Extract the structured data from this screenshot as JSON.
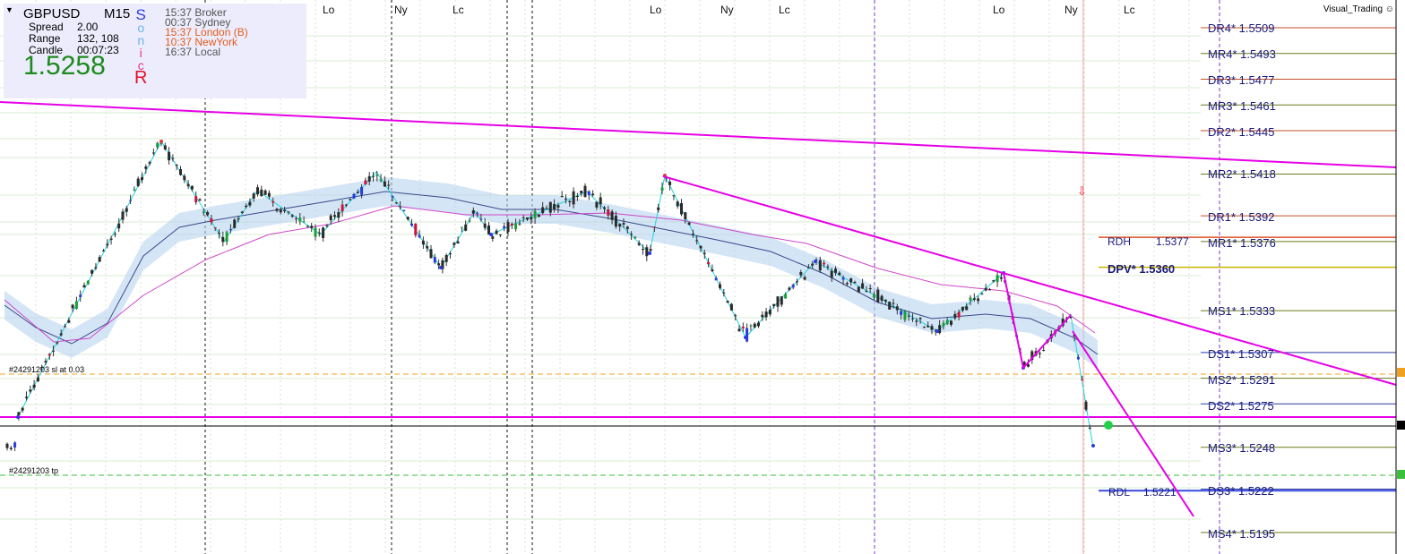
{
  "header": {
    "dropdown": "▼",
    "symbol": "GBPUSD",
    "timeframe": "M15",
    "spread_label": "Spread",
    "spread": "2.00",
    "range_label": "Range",
    "range": "132, 108",
    "candle_label": "Candle",
    "candle": "00:07:23",
    "price": "1.5258",
    "sonic": [
      "S",
      "o",
      "n",
      "i",
      "c",
      "R"
    ],
    "sessions": [
      {
        "text": "15:37 Broker",
        "color": "#555555"
      },
      {
        "text": "00:37 Sydney",
        "color": "#555555"
      },
      {
        "text": "15:37 London  (B)",
        "color": "#e25c1c"
      },
      {
        "text": "10:37 NewYork",
        "color": "#e25c1c"
      },
      {
        "text": "16:37 Local",
        "color": "#555555"
      }
    ],
    "visual_trading": "Visual_Trading ☺"
  },
  "session_labels": [
    "Lo",
    "Ny",
    "Lc",
    "Lo",
    "Ny",
    "Lc",
    "Lo",
    "Ny",
    "Lc"
  ],
  "pivots": [
    {
      "label": "DR4* 1.5509",
      "bold": false,
      "price": 1.5509
    },
    {
      "label": "MR4* 1.5493",
      "bold": false,
      "price": 1.5493
    },
    {
      "label": "DR3* 1.5477",
      "bold": false,
      "price": 1.5477
    },
    {
      "label": "MR3* 1.5461",
      "bold": false,
      "price": 1.5461
    },
    {
      "label": "DR2* 1.5445",
      "bold": false,
      "price": 1.5445
    },
    {
      "label": "MR2* 1.5418",
      "bold": false,
      "price": 1.5418
    },
    {
      "label": "DR1* 1.5392",
      "bold": false,
      "price": 1.5392
    },
    {
      "label": "MR1* 1.5376",
      "bold": false,
      "price": 1.5376
    },
    {
      "label": "MS1* 1.5333",
      "bold": false,
      "price": 1.5333
    },
    {
      "label": "DS1* 1.5307",
      "bold": false,
      "price": 1.5307
    },
    {
      "label": "MS2* 1.5291",
      "bold": false,
      "price": 1.5291
    },
    {
      "label": "DS2* 1.5275",
      "bold": false,
      "price": 1.5275
    },
    {
      "label": "MS3* 1.5248",
      "bold": false,
      "price": 1.5248
    },
    {
      "label": "DS3* 1.5222",
      "bold": false,
      "price": 1.5222
    },
    {
      "label": "MS4* 1.5195",
      "bold": false,
      "price": 1.5195
    }
  ],
  "rdh": {
    "name": "RDH",
    "value": "1.5377"
  },
  "dpv": {
    "label": "DPV* 1.5360"
  },
  "rdl": {
    "name": "RDL",
    "value": "1.5221"
  },
  "orders": {
    "sl": "#24291203 sl  at 0.03",
    "tp": "#24291203 tp"
  },
  "colors": {
    "trendline": "#e600e6",
    "zigzag": "#22d3e0",
    "bull": "#1a9e3a",
    "bear": "#d0103a",
    "body": "#2a2a2a",
    "band": "#b8d4f0",
    "ma_slow": "#d048c8",
    "ma_fast": "#3a4a8a",
    "pivot_line_up": "#c0502a",
    "pivot_line_mid": "#6a7a1a",
    "pivot_line_down": "#2a3aa0"
  }
}
